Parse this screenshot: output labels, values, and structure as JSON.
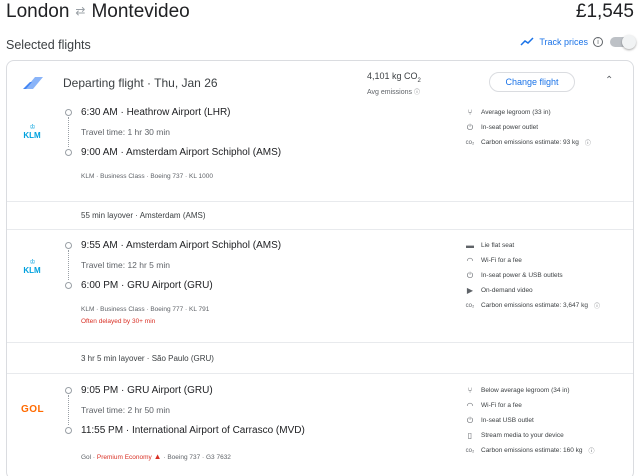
{
  "header": {
    "origin": "London",
    "swap_icon": "swap-arrows-icon",
    "destination": "Montevideo",
    "price": "£1,545"
  },
  "selected_label": "Selected flights",
  "track": {
    "label": "Track prices",
    "on": false
  },
  "departing": {
    "title": "Departing flight · Thu, Jan 26",
    "co2": "4,101 kg CO",
    "co2_sub": "2",
    "co2_note": "Avg emissions",
    "change_label": "Change flight"
  },
  "segments": [
    {
      "airline": "KLM",
      "dep": "6:30 AM · Heathrow Airport (LHR)",
      "travel": "Travel time: 1 hr 30 min",
      "arr": "9:00 AM · Amsterdam Airport Schiphol (AMS)",
      "meta": "KLM · Business Class · Boeing 737 · KL 1000",
      "warning": "",
      "amenities": [
        {
          "icon": "legroom-icon",
          "text": "Average legroom (33 in)"
        },
        {
          "icon": "power-outlet-icon",
          "text": "In-seat power outlet"
        },
        {
          "icon": "co2-icon",
          "text": "Carbon emissions estimate: 93 kg"
        }
      ]
    },
    {
      "airline": "KLM",
      "dep": "9:55 AM · Amsterdam Airport Schiphol (AMS)",
      "travel": "Travel time: 12 hr 5 min",
      "arr": "6:00 PM · GRU Airport (GRU)",
      "meta": "KLM · Business Class · Boeing 777 · KL 791",
      "warning": "Often delayed by 30+ min",
      "amenities": [
        {
          "icon": "flat-seat-icon",
          "text": "Lie flat seat"
        },
        {
          "icon": "wifi-icon",
          "text": "Wi-Fi for a fee"
        },
        {
          "icon": "power-outlet-icon",
          "text": "In-seat power & USB outlets"
        },
        {
          "icon": "video-icon",
          "text": "On-demand video"
        },
        {
          "icon": "co2-icon",
          "text": "Carbon emissions estimate: 3,647 kg"
        }
      ]
    },
    {
      "airline": "GOL",
      "dep": "9:05 PM · GRU Airport (GRU)",
      "travel": "Travel time: 2 hr 50 min",
      "arr": "11:55 PM · International Airport of Carrasco (MVD)",
      "meta_prefix": "Gol · ",
      "meta_premium": "Premium Economy",
      "meta_suffix": " · Boeing 737 · G3 7632",
      "amenities": [
        {
          "icon": "legroom-icon",
          "text": "Below average legroom (34 in)"
        },
        {
          "icon": "wifi-icon",
          "text": "Wi-Fi for a fee"
        },
        {
          "icon": "usb-outlet-icon",
          "text": "In-seat USB outlet"
        },
        {
          "icon": "stream-icon",
          "text": "Stream media to your device"
        },
        {
          "icon": "co2-icon",
          "text": "Carbon emissions estimate: 160 kg"
        }
      ]
    }
  ],
  "layovers": [
    "55 min layover · Amsterdam (AMS)",
    "3 hr 5 min layover · São Paulo (GRU)"
  ]
}
